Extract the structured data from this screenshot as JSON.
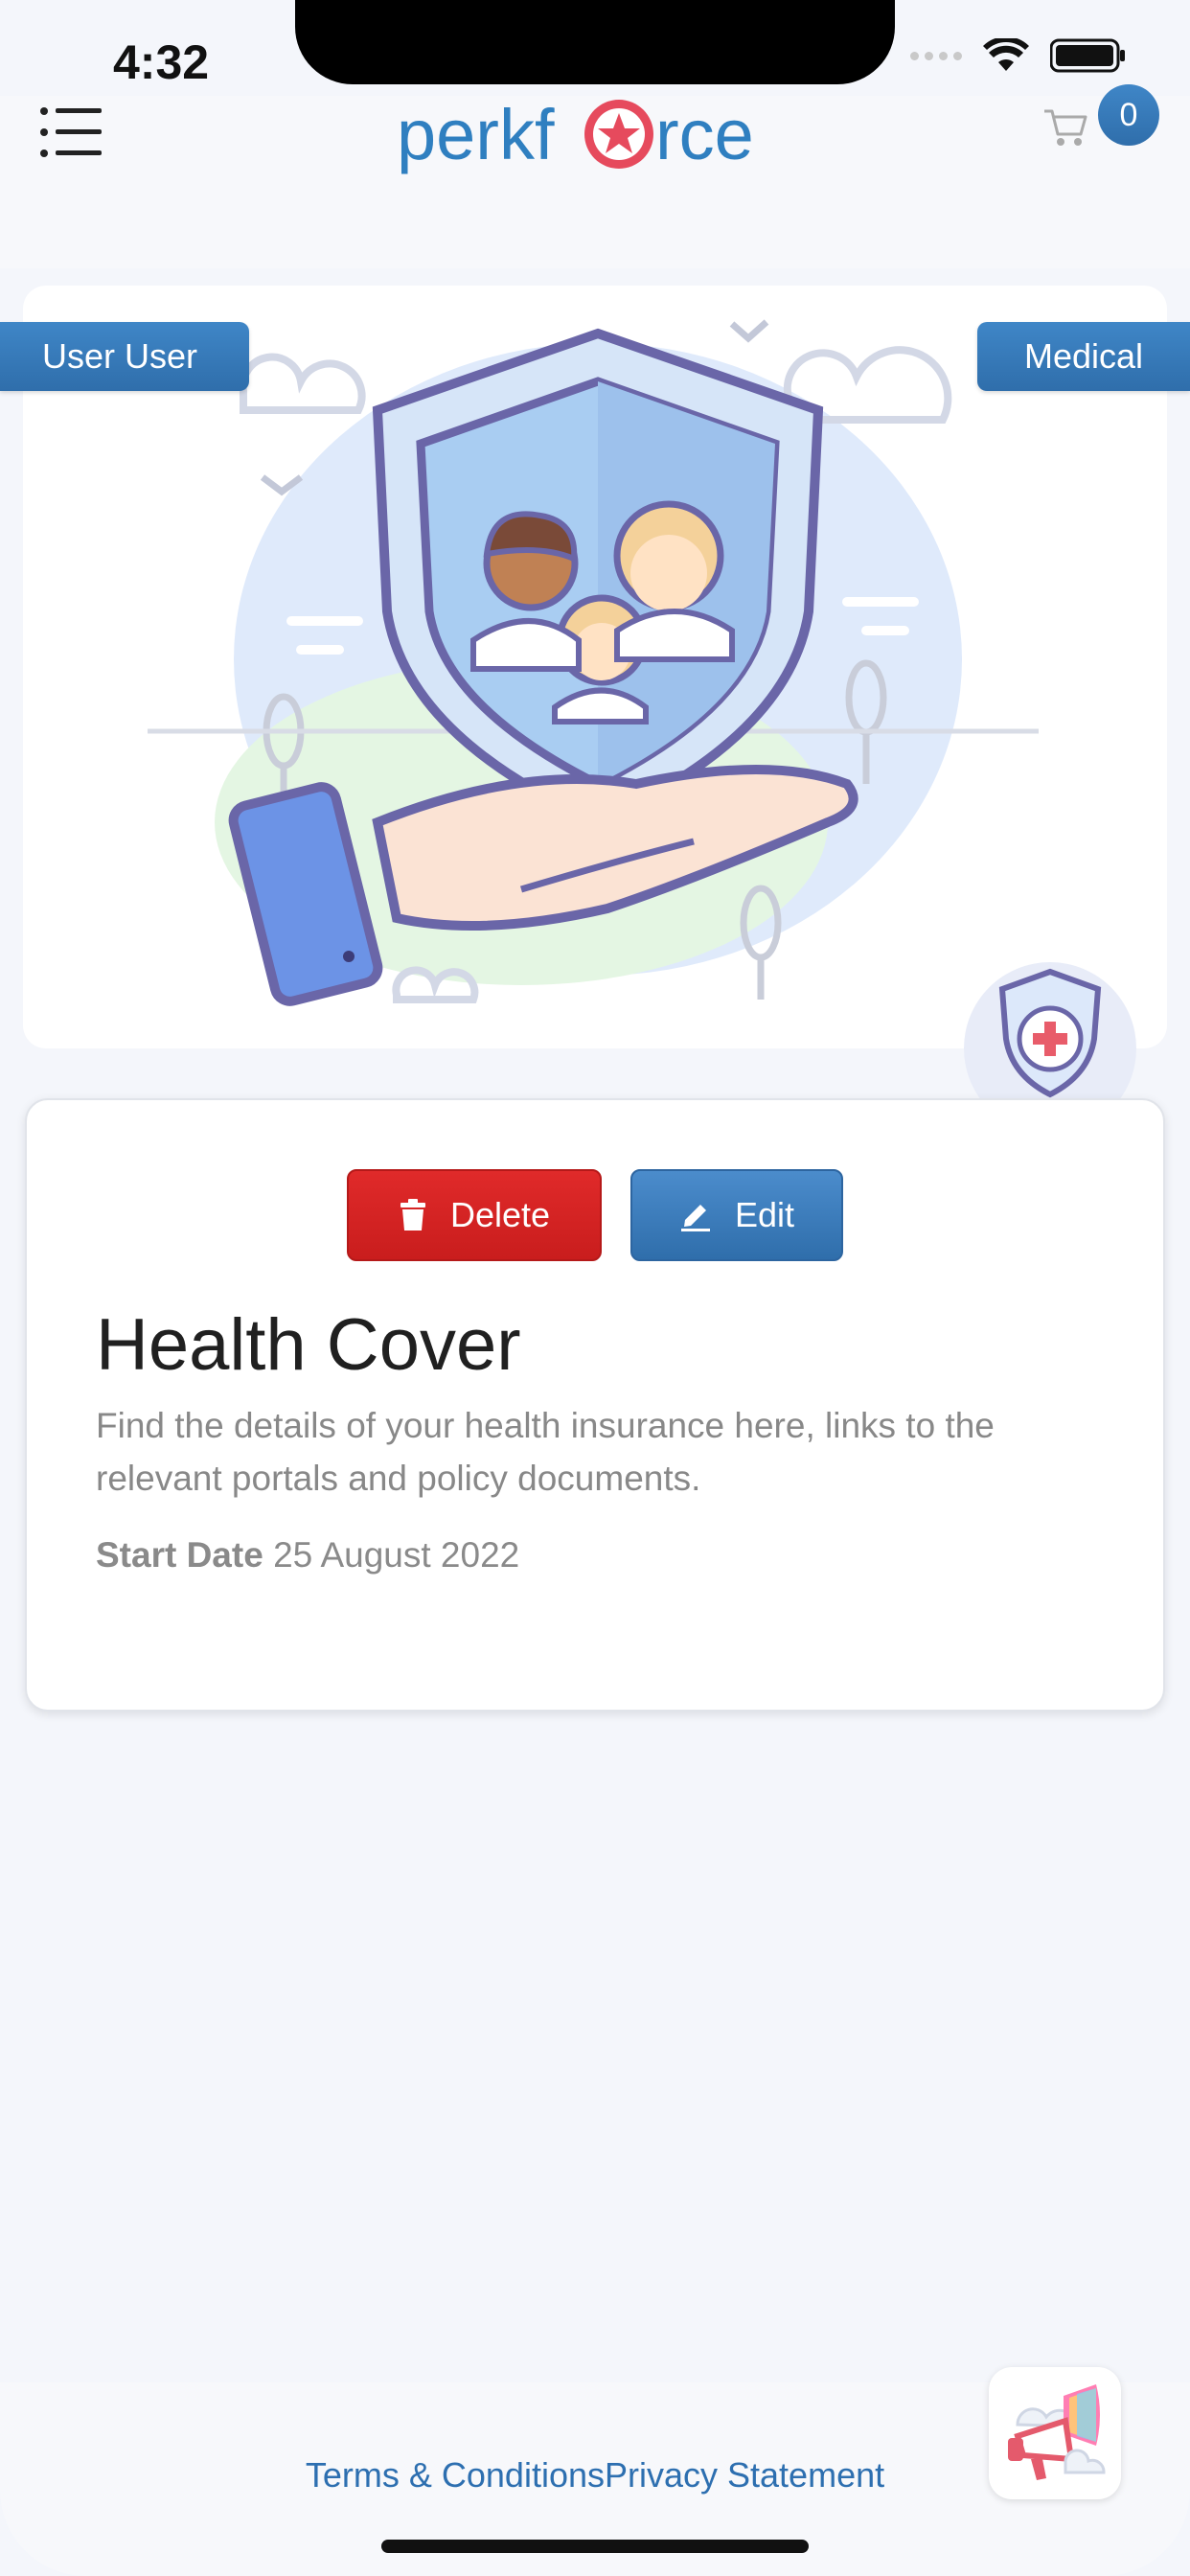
{
  "status_bar": {
    "time": "4:32"
  },
  "header": {
    "brand": "perkforce",
    "cart_count": "0"
  },
  "hero": {
    "tag_left": "User User",
    "tag_right": "Medical",
    "illustration": "hand-holding-family-shield",
    "badge_icon": "medical-shield-icon"
  },
  "card": {
    "delete_label": "Delete",
    "edit_label": "Edit",
    "title": "Health Cover",
    "description": "Find the details of your health insurance here, links to the relevant portals and policy documents.",
    "start_date_label": "Start Date",
    "start_date_value": "25 August 2022"
  },
  "footer": {
    "terms_label": "Terms & Conditions",
    "privacy_label": "Privacy Statement"
  },
  "colors": {
    "primary": "#2f6eab",
    "danger": "#d42222",
    "background": "#f4f6fb",
    "text_dark": "#202020",
    "text_muted": "#888888"
  }
}
